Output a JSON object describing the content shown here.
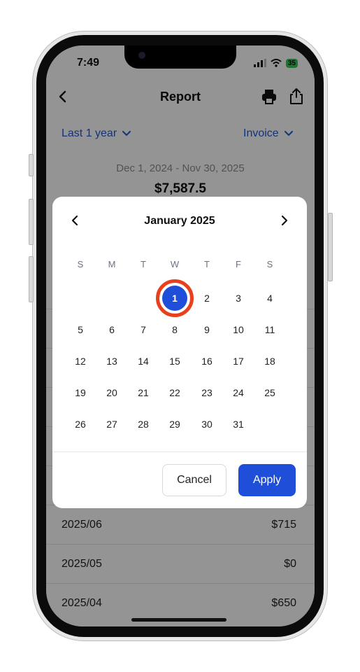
{
  "status_bar": {
    "time": "7:49",
    "battery": "35"
  },
  "header": {
    "title": "Report"
  },
  "filters": {
    "period": "Last 1 year",
    "type": "Invoice"
  },
  "summary": {
    "range": "Dec 1, 2024 - Nov 30, 2025",
    "total": "$7,587.5"
  },
  "report_rows": [
    {
      "month": "2025/06",
      "amount": "$715"
    },
    {
      "month": "2025/05",
      "amount": "$0"
    },
    {
      "month": "2025/04",
      "amount": "$650"
    }
  ],
  "calendar": {
    "month_label": "January 2025",
    "weekdays": [
      "S",
      "M",
      "T",
      "W",
      "T",
      "F",
      "S"
    ],
    "first_weekday": 3,
    "days_in_month": 31,
    "selected_day": 1,
    "colors": {
      "selected": "#1f4fd9",
      "highlight_ring": "#e8401c"
    }
  },
  "actions": {
    "cancel": "Cancel",
    "apply": "Apply"
  },
  "colors": {
    "accent": "#2459d6"
  }
}
